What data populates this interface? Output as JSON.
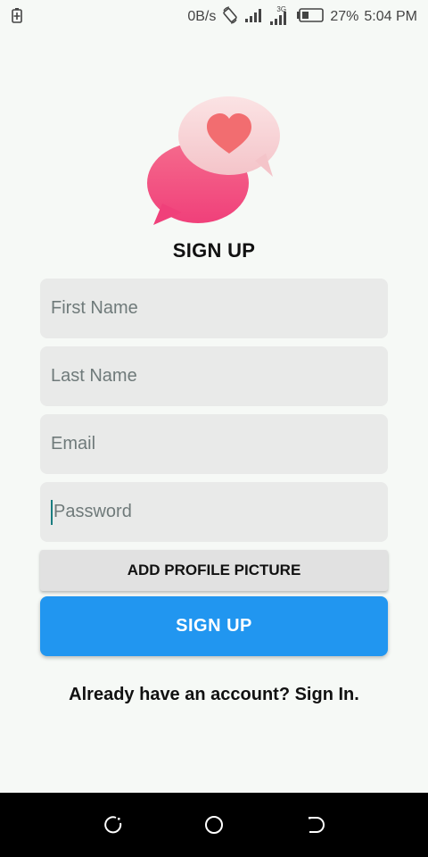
{
  "status_bar": {
    "net_speed": "0B/s",
    "network_type": "3G",
    "battery": "27%",
    "time": "5:04 PM"
  },
  "title": "SIGN UP",
  "form": {
    "first_name_placeholder": "First Name",
    "last_name_placeholder": "Last Name",
    "email_placeholder": "Email",
    "password_placeholder": "Password"
  },
  "buttons": {
    "add_profile_picture": "ADD PROFILE PICTURE",
    "sign_up": "SIGN UP"
  },
  "signin_link": "Already have an account? Sign In.",
  "colors": {
    "primary": "#2196f0",
    "background": "#f6f9f6",
    "field": "#e9eae9",
    "logo_pink": "#f04a7a",
    "logo_light": "#f7cfd3",
    "heart": "#f26d70"
  },
  "icons": {
    "status_left": "battery-charging-icon",
    "status": [
      "auto-rotate-icon",
      "signal-icon",
      "signal-3g-icon",
      "battery-icon"
    ],
    "nav": [
      "recent-apps-icon",
      "home-icon",
      "back-icon"
    ]
  }
}
